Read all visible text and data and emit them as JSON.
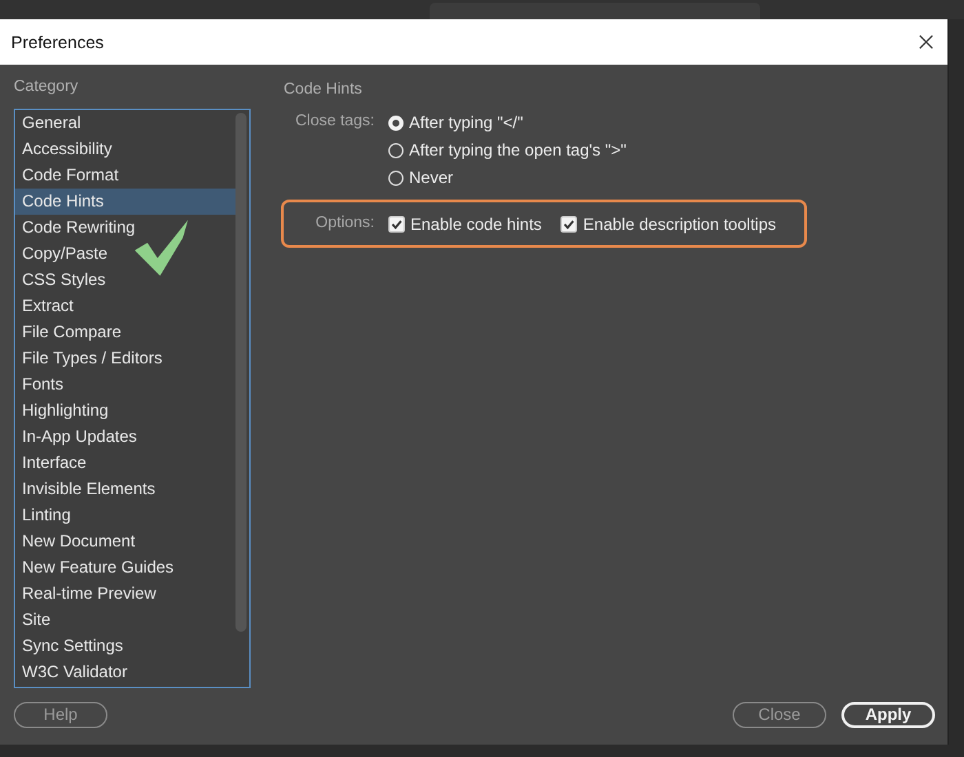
{
  "window": {
    "title": "Preferences"
  },
  "category_panel": {
    "heading": "Category",
    "items": [
      {
        "label": "General",
        "selected": false
      },
      {
        "label": "Accessibility",
        "selected": false
      },
      {
        "label": "Code Format",
        "selected": false
      },
      {
        "label": "Code Hints",
        "selected": true
      },
      {
        "label": "Code Rewriting",
        "selected": false
      },
      {
        "label": "Copy/Paste",
        "selected": false
      },
      {
        "label": "CSS Styles",
        "selected": false
      },
      {
        "label": "Extract",
        "selected": false
      },
      {
        "label": "File Compare",
        "selected": false
      },
      {
        "label": "File Types / Editors",
        "selected": false
      },
      {
        "label": "Fonts",
        "selected": false
      },
      {
        "label": "Highlighting",
        "selected": false
      },
      {
        "label": "In-App Updates",
        "selected": false
      },
      {
        "label": "Interface",
        "selected": false
      },
      {
        "label": "Invisible Elements",
        "selected": false
      },
      {
        "label": "Linting",
        "selected": false
      },
      {
        "label": "New Document",
        "selected": false
      },
      {
        "label": "New Feature Guides",
        "selected": false
      },
      {
        "label": "Real-time Preview",
        "selected": false
      },
      {
        "label": "Site",
        "selected": false
      },
      {
        "label": "Sync Settings",
        "selected": false
      },
      {
        "label": "W3C Validator",
        "selected": false
      }
    ]
  },
  "content": {
    "heading": "Code Hints",
    "close_tags": {
      "label": "Close tags:",
      "options": [
        {
          "label": "After typing \"</\"",
          "selected": true
        },
        {
          "label": "After typing the open tag's \">\"",
          "selected": false
        },
        {
          "label": "Never",
          "selected": false
        }
      ]
    },
    "options": {
      "label": "Options:",
      "checkboxes": [
        {
          "label": "Enable code hints",
          "checked": true
        },
        {
          "label": "Enable description tooltips",
          "checked": true
        }
      ]
    }
  },
  "buttons": [
    {
      "label": "Help",
      "kind": "secondary"
    },
    {
      "label": "Close",
      "kind": "secondary"
    },
    {
      "label": "Apply",
      "kind": "primary"
    }
  ]
}
